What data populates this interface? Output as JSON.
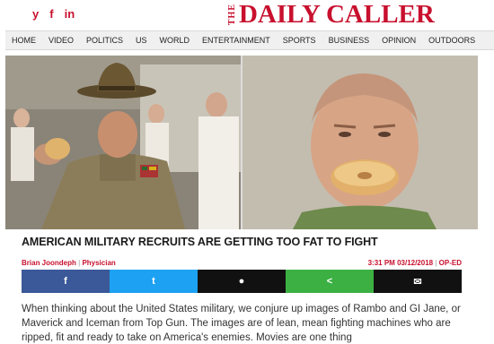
{
  "social": {
    "twitter_glyph": "𝕏",
    "twitter_label": "y",
    "facebook_label": "f",
    "linkedin_label": "in"
  },
  "logo": {
    "the": "THE",
    "name": "DAILY CALLER"
  },
  "nav": {
    "items": [
      "HOME",
      "VIDEO",
      "POLITICS",
      "US",
      "WORLD",
      "ENTERTAINMENT",
      "SPORTS",
      "BUSINESS",
      "OPINION",
      "OUTDOORS"
    ]
  },
  "article": {
    "headline": "AMERICAN MILITARY RECRUITS ARE GETTING TOO FAT TO FIGHT",
    "author": "Brian Joondeph",
    "author_role": "Physician",
    "timestamp": "3:31 PM 03/12/2018",
    "section": "OP-ED",
    "body": "When thinking about the United States military, we conjure up images of Rambo and GI Jane, or Maverick and Iceman from Top Gun. The images are of lean, mean fighting machines who are ripped, fit and ready to take on America's enemies. Movies are one thing"
  },
  "share": {
    "facebook": "f",
    "twitter": "t",
    "comment": "●",
    "share": "<",
    "email": "✉"
  },
  "colors": {
    "brand_red": "#c8102e",
    "facebook": "#3b5998",
    "twitter": "#1da1f2",
    "comment": "#111111",
    "share": "#3cb043",
    "email": "#111111"
  }
}
